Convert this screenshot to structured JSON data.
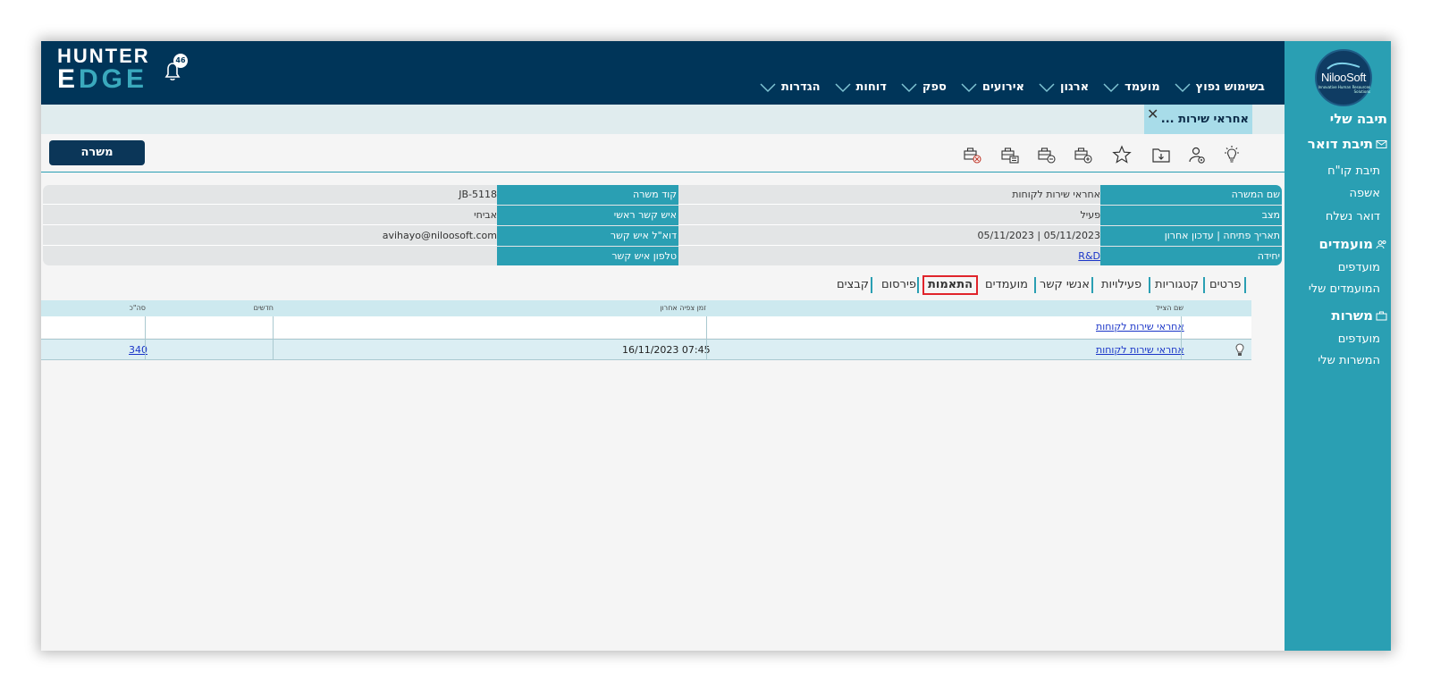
{
  "header": {
    "logo_line1": "HUNTER",
    "logo_line2_a": "E",
    "logo_line2_b": "DGE",
    "notification_count": "46",
    "nav": [
      "בשימוש נפוץ",
      "מועמד",
      "ארגון",
      "אירועים",
      "ספק",
      "דוחות",
      "הגדרות"
    ]
  },
  "brand": {
    "name": "NilooSoft",
    "tagline": "Innovative Human Resources Solutions"
  },
  "sidebar": {
    "my_inbox": "תיבה שלי",
    "mail_header": "תיבת דואר",
    "mail_items": [
      "תיבת קו\"ח",
      "אשפה",
      "דואר נשלח"
    ],
    "candidates_header": "מועמדים",
    "candidates_items": [
      "מועדפים",
      "המועמדים שלי"
    ],
    "jobs_header": "משרות",
    "jobs_items": [
      "מועדפים",
      "המשרות שלי"
    ]
  },
  "open_tab": {
    "label": "אחראי שירות ...",
    "close": "✕"
  },
  "toolbar": {
    "job_button": "משרה",
    "icons": [
      "lightbulb-icon",
      "user-settings-icon",
      "folder-download-icon",
      "star-icon",
      "job-add-icon",
      "job-minus-icon",
      "job-edit-icon",
      "job-delete-icon"
    ]
  },
  "info": {
    "job_name_label": "שם המשרה",
    "job_name_value": "אחראי שירות לקוחות",
    "job_code_label": "קוד משרה",
    "job_code_value": "JB-5118",
    "status_label": "מצב",
    "status_value": "פעיל",
    "main_contact_label": "איש קשר ראשי",
    "main_contact_value": "אביחי",
    "dates_label": "תאריך פתיחה | עדכון אחרון",
    "dates_value": "05/11/2023 | 05/11/2023",
    "contact_email_label": "דוא\"ל איש קשר",
    "contact_email_value": "avihayo@niloosoft.com",
    "unit_label": "יחידה",
    "unit_value": "R&D",
    "contact_phone_label": "טלפון איש קשר",
    "contact_phone_value": ""
  },
  "subtabs": [
    "פרטים",
    "קטגוריות",
    "פעילויות",
    "אנשי קשר",
    "מועמדים",
    "התאמות",
    "פירסום",
    "קבצים"
  ],
  "active_subtab": "התאמות",
  "table": {
    "headers": {
      "agent_name": "שם הצייד",
      "last_view": "זמן צפיה אחרון",
      "new": "חדשים",
      "total": "סה\"כ"
    },
    "rows": [
      {
        "agent_name": "אחראי שירות לקוחות",
        "last_view": "",
        "new": "",
        "total": ""
      },
      {
        "agent_name": "אחראי שירות לקוחות",
        "last_view": "16/11/2023 07:45",
        "new": "",
        "total": "340"
      }
    ]
  },
  "colors": {
    "navy": "#003559",
    "teal": "#2a9fb3",
    "tab_highlight": "#e0242b"
  }
}
